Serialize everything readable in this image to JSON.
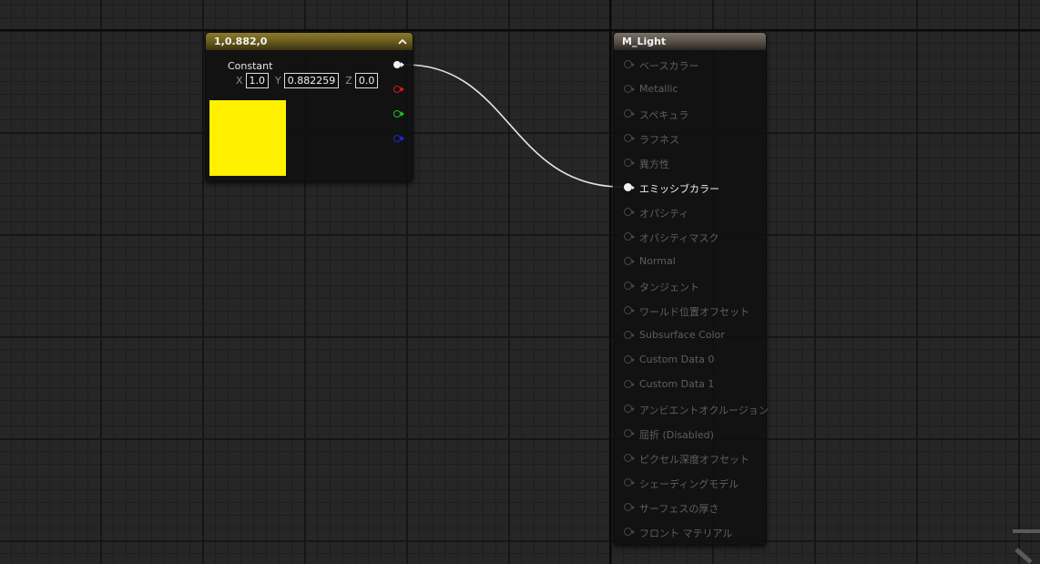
{
  "constant_node": {
    "title": "1,0.882,0",
    "collapse_glyph": "^",
    "label": "Constant",
    "x_label": "X",
    "x_value": "1.0",
    "y_label": "Y",
    "y_value": "0.882259",
    "z_label": "Z",
    "z_value": "0.0",
    "swatch_color": "#fff100",
    "header_color": "#7a6b26"
  },
  "material_node": {
    "title": "M_Light",
    "header_color": "#655c54",
    "inputs": [
      {
        "label": "ベースカラー",
        "connected": false
      },
      {
        "label": "Metallic",
        "connected": false
      },
      {
        "label": "スペキュラ",
        "connected": false
      },
      {
        "label": "ラフネス",
        "connected": false
      },
      {
        "label": "異方性",
        "connected": false
      },
      {
        "label": "エミッシブカラー",
        "connected": true
      },
      {
        "label": "オパシティ",
        "connected": false
      },
      {
        "label": "オパシティマスク",
        "connected": false
      },
      {
        "label": "Normal",
        "connected": false
      },
      {
        "label": "タンジェント",
        "connected": false
      },
      {
        "label": "ワールド位置オフセット",
        "connected": false
      },
      {
        "label": "Subsurface Color",
        "connected": false
      },
      {
        "label": "Custom Data 0",
        "connected": false
      },
      {
        "label": "Custom Data 1",
        "connected": false
      },
      {
        "label": "アンビエントオクルージョン",
        "connected": false
      },
      {
        "label": "屈折 (Disabled)",
        "connected": false
      },
      {
        "label": "ピクセル深度オフセット",
        "connected": false
      },
      {
        "label": "シェーディングモデル",
        "connected": false
      },
      {
        "label": "サーフェスの厚さ",
        "connected": false
      },
      {
        "label": "フロント マテリアル",
        "connected": false
      }
    ]
  },
  "output_pins": [
    {
      "name": "rgb",
      "color": "#f2f2f2"
    },
    {
      "name": "r",
      "color": "#d01818"
    },
    {
      "name": "g",
      "color": "#20c020"
    },
    {
      "name": "b",
      "color": "#1a2ad8"
    }
  ],
  "wire_color": "#e6e6e6"
}
